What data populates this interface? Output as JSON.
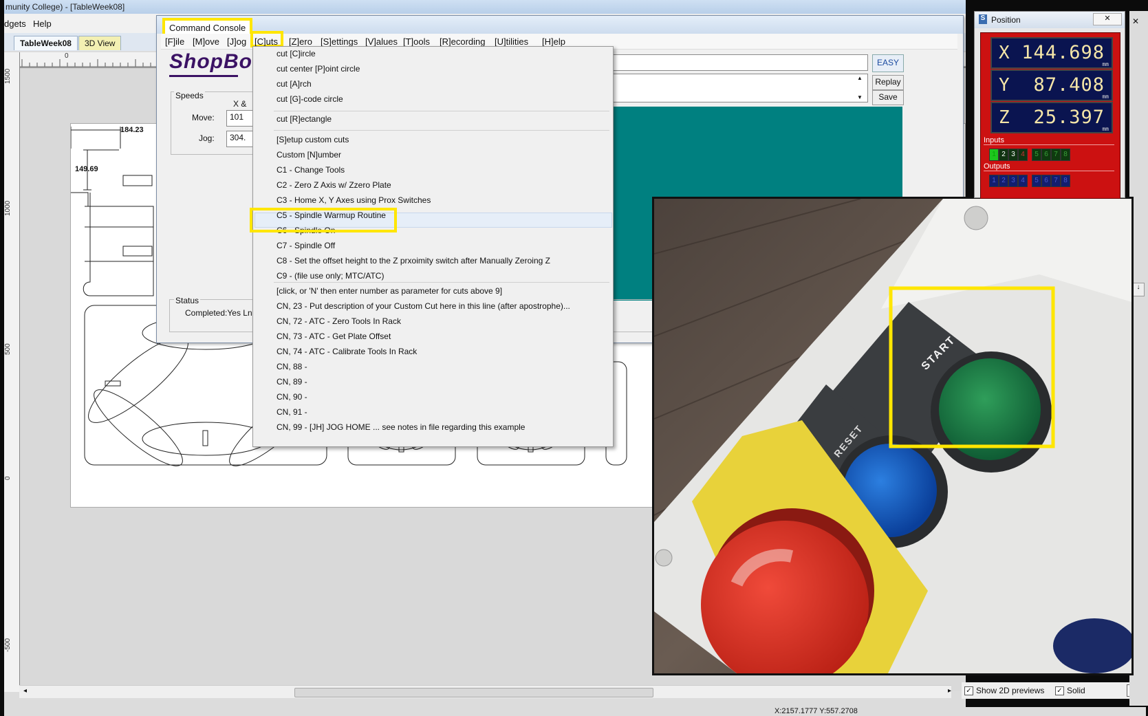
{
  "app": {
    "title": "munity College) - [TableWeek08]",
    "menu": [
      "dgets",
      "Help"
    ],
    "tabs": [
      "TableWeek08",
      "3D View"
    ],
    "ruler_top": [
      "0"
    ],
    "ruler_left": [
      "1500",
      "1000",
      "500",
      "0",
      "-500"
    ],
    "dims": [
      "184.23",
      "149.69"
    ],
    "bottom_options": {
      "show_previews": "Show 2D previews",
      "solid": "Solid"
    },
    "status": "X:2157.1777 Y:557.2708"
  },
  "console": {
    "title": "Command Console",
    "menu": [
      "[F]ile",
      "[M]ove",
      "[J]og",
      "[C]uts",
      "[Z]ero",
      "[S]ettings",
      "[V]alues",
      "[T]ools",
      "[R]ecording",
      "[U]tilities",
      "[H]elp"
    ],
    "logo": "ShopBot",
    "speeds": {
      "title": "Speeds",
      "col": "X &",
      "move_label": "Move:",
      "move_value": "101",
      "jog_label": "Jog:",
      "jog_value": "304."
    },
    "easy": "EASY",
    "replay": "Replay",
    "save": "Save",
    "status": {
      "title": "Status",
      "text": "Completed:Yes Ln:"
    }
  },
  "cuts_menu": {
    "items": [
      "cut [C]ircle",
      "cut center [P]oint circle",
      "cut [A]rch",
      "cut [G]-code circle",
      "cut [R]ectangle",
      "[S]etup custom cuts",
      "Custom [N]umber",
      "C1  -  Change Tools",
      "C2  -  Zero Z Axis w/ Zzero Plate",
      "C3  -  Home X, Y Axes using Prox Switches",
      "C5  -  Spindle Warmup Routine",
      "C6  -  Spindle On",
      "C7  -  Spindle Off",
      "C8  -  Set the offset height to the Z prxoimity switch after Manually Zeroing Z",
      "C9  -  (file use only; MTC/ATC)",
      "[click, or 'N' then enter number as parameter for cuts above 9]",
      "CN, 23  -  Put description of your Custom Cut here in this line (after apostrophe)...",
      "CN, 72  -  ATC - Zero Tools In Rack",
      "CN, 73  -  ATC - Get Plate Offset",
      "CN, 74  -  ATC - Calibrate Tools In Rack",
      "CN, 88  -",
      "CN, 89  -",
      "CN, 90  -",
      "CN, 91  -",
      "CN, 99  -  [JH] JOG HOME ... see notes in file regarding this example"
    ],
    "highlighted": "C5  -  Spindle Warmup Routine"
  },
  "position": {
    "title": "Position",
    "x": {
      "axis": "X",
      "value": "144.698",
      "unit": "mm"
    },
    "y": {
      "axis": "Y",
      "value": "87.408",
      "unit": "mm"
    },
    "z": {
      "axis": "Z",
      "value": "25.397",
      "unit": "mm"
    },
    "inputs_label": "Inputs",
    "inputs": [
      "1",
      "2",
      "3",
      "4",
      "5",
      "6",
      "7",
      "8"
    ],
    "outputs_label": "Outputs",
    "outputs": [
      "1",
      "2",
      "3",
      "4",
      "5",
      "6",
      "7",
      "8"
    ]
  },
  "photo": {
    "start": "START",
    "reset": "RESET"
  },
  "colors": {
    "highlight": "#ffe600",
    "teal": "#008080",
    "panel_red": "#cc1111",
    "logo": "#3b1264"
  }
}
